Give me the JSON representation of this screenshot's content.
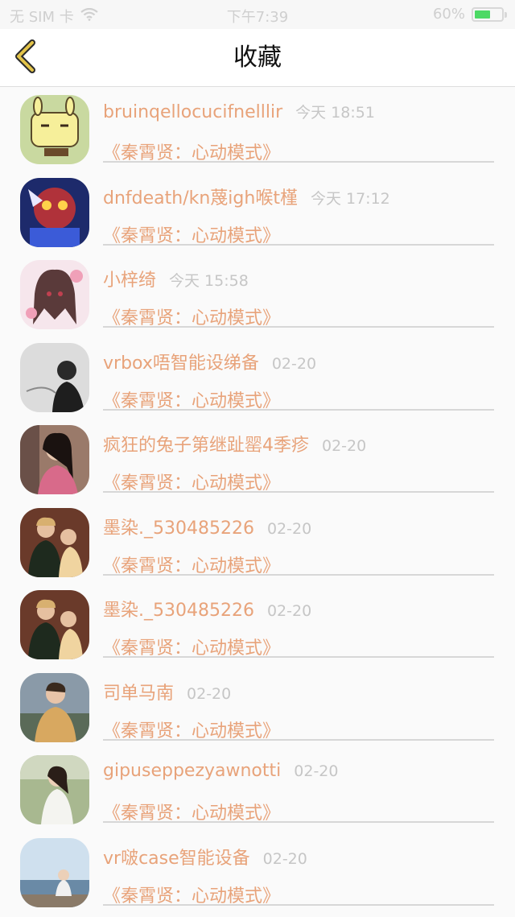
{
  "status_bar": {
    "carrier": "无 SIM 卡",
    "time": "下午7:39",
    "battery_text": "60%",
    "battery_level": 0.6
  },
  "nav": {
    "back_icon": "chevron-left-icon",
    "title": "收藏"
  },
  "colors": {
    "accent": "#e8a37a",
    "back_chevron": "#e2c349",
    "time_text": "#c6c6c6",
    "divider": "#d7d7d7"
  },
  "items": [
    {
      "username": "bruinqellocucifnelllir",
      "time": "今天 18:51",
      "work": "《秦霄贤：心动模式》"
    },
    {
      "username": "dnfdeath/kn蔑igh喉t槿",
      "time": "今天 17:12",
      "work": "《秦霄贤：心动模式》"
    },
    {
      "username": "小梓绮",
      "time": "今天 15:58",
      "work": "《秦霄贤：心动模式》"
    },
    {
      "username": "vrbox唔智能设绨备",
      "time": "02-20",
      "work": "《秦霄贤：心动模式》"
    },
    {
      "username": "疯狂的兔子第继趾罂4季疹",
      "time": "02-20",
      "work": "《秦霄贤：心动模式》"
    },
    {
      "username": "墨染._530485226",
      "time": "02-20",
      "work": "《秦霄贤：心动模式》"
    },
    {
      "username": "墨染._530485226",
      "time": "02-20",
      "work": "《秦霄贤：心动模式》"
    },
    {
      "username": "司单马南",
      "time": "02-20",
      "work": "《秦霄贤：心动模式》"
    },
    {
      "username": "gipuseppezyawnotti",
      "time": "02-20",
      "work": "《秦霄贤：心动模式》"
    },
    {
      "username": "vr啵case智能设备",
      "time": "02-20",
      "work": "《秦霄贤：心动模式》"
    }
  ]
}
